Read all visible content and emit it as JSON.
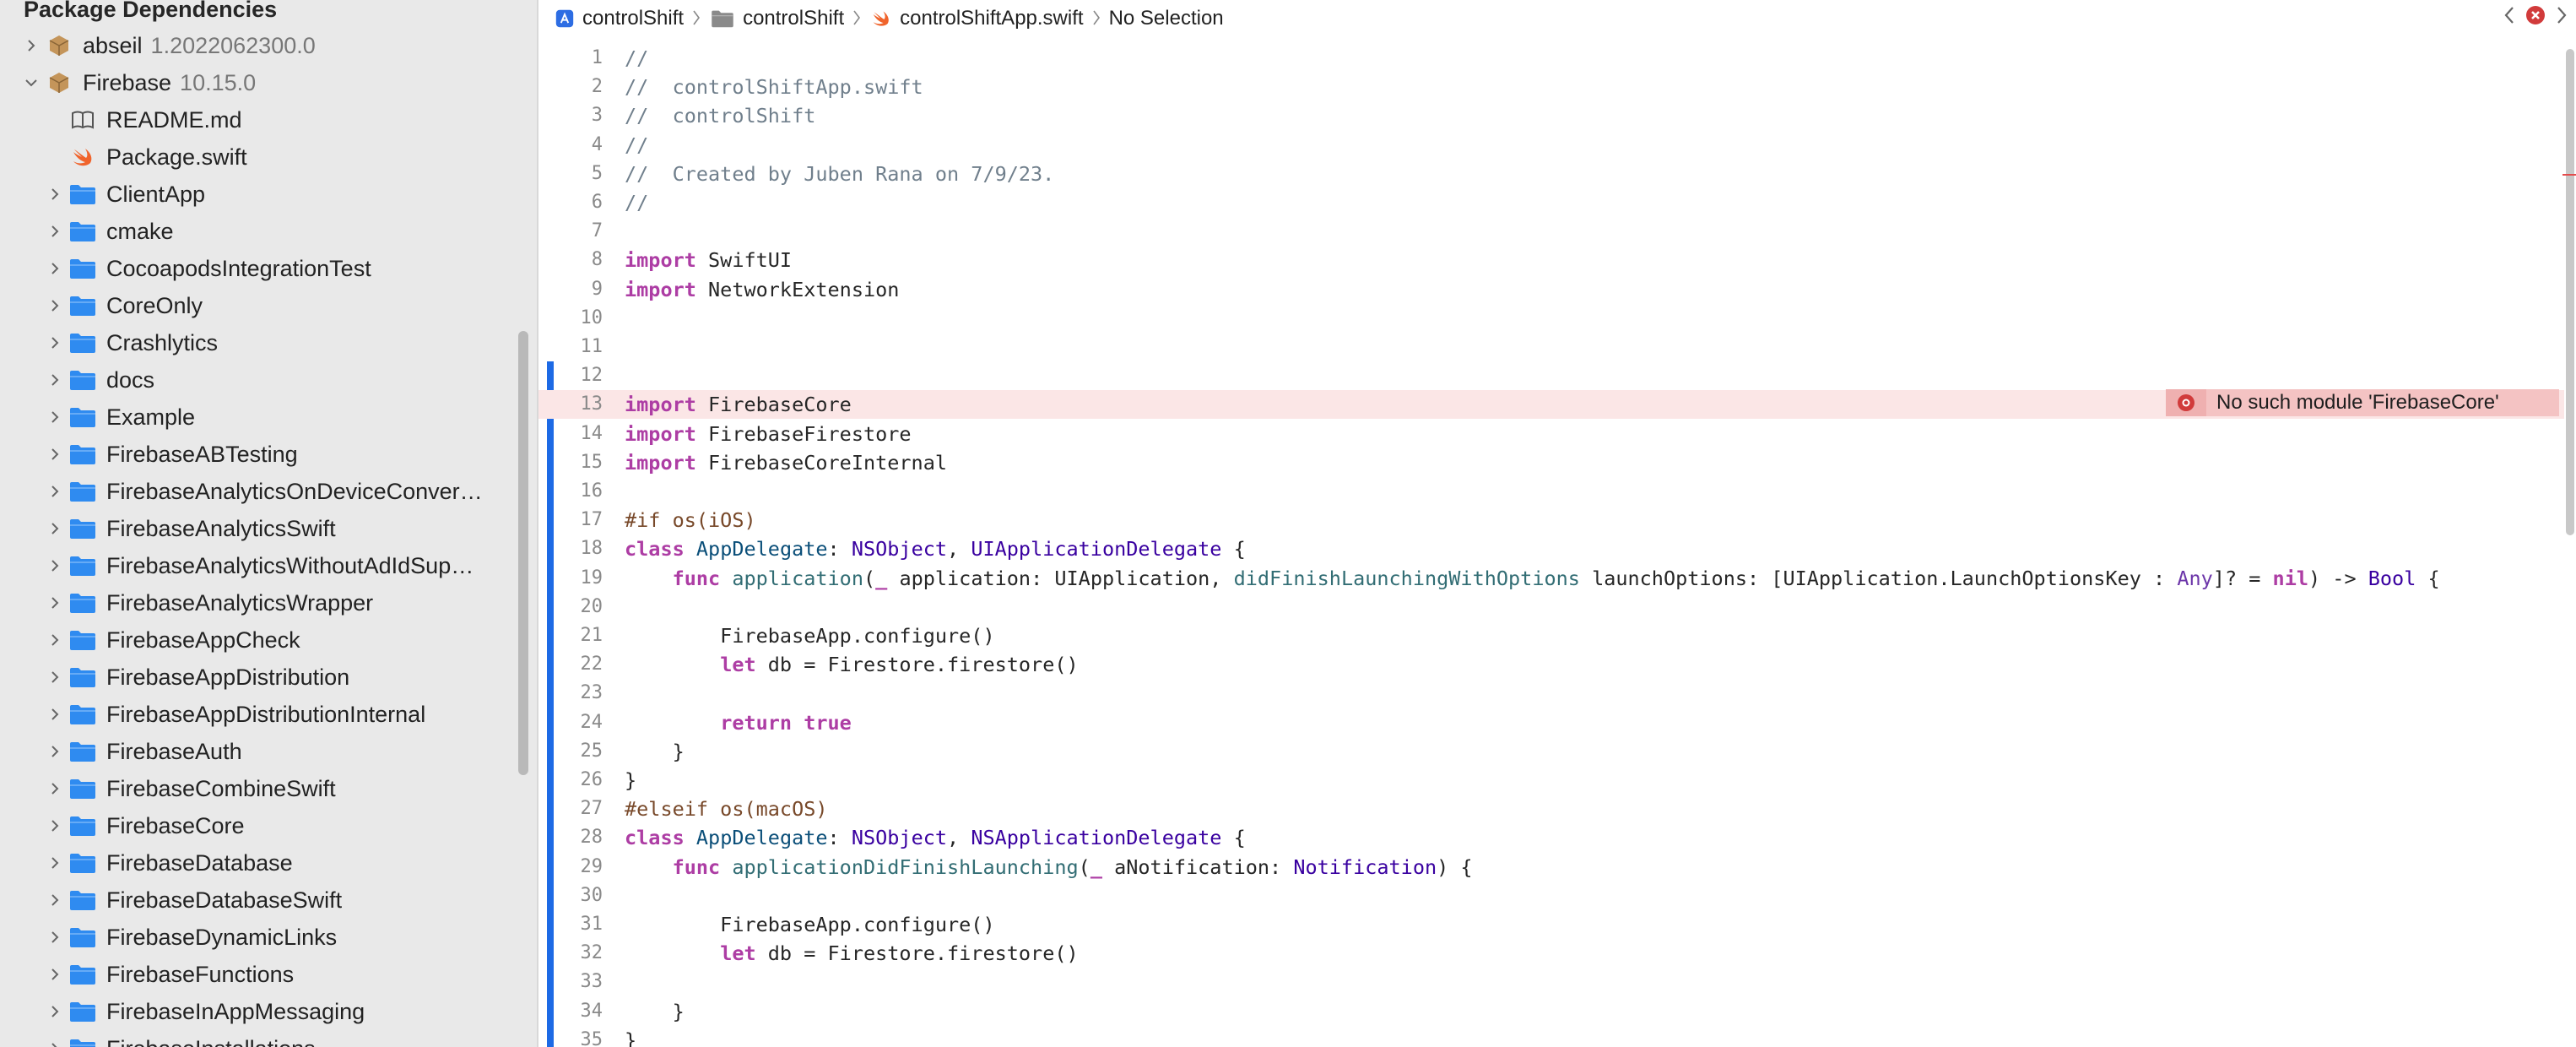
{
  "sidebar": {
    "header": "Package Dependencies",
    "rows": [
      {
        "label": "abseil",
        "version": "1.2022062300.0",
        "indent": 0,
        "icon": "package-icon",
        "expandable": true,
        "expanded": false
      },
      {
        "label": "Firebase",
        "version": "10.15.0",
        "indent": 0,
        "icon": "package-icon",
        "expandable": true,
        "expanded": true
      },
      {
        "label": "README.md",
        "version": "",
        "indent": 1,
        "icon": "book-icon",
        "expandable": false,
        "expanded": false
      },
      {
        "label": "Package.swift",
        "version": "",
        "indent": 1,
        "icon": "swift-icon",
        "expandable": false,
        "expanded": false
      },
      {
        "label": "ClientApp",
        "version": "",
        "indent": 1,
        "icon": "folder-icon",
        "expandable": true,
        "expanded": false
      },
      {
        "label": "cmake",
        "version": "",
        "indent": 1,
        "icon": "folder-icon",
        "expandable": true,
        "expanded": false
      },
      {
        "label": "CocoapodsIntegrationTest",
        "version": "",
        "indent": 1,
        "icon": "folder-icon",
        "expandable": true,
        "expanded": false
      },
      {
        "label": "CoreOnly",
        "version": "",
        "indent": 1,
        "icon": "folder-icon",
        "expandable": true,
        "expanded": false
      },
      {
        "label": "Crashlytics",
        "version": "",
        "indent": 1,
        "icon": "folder-icon",
        "expandable": true,
        "expanded": false
      },
      {
        "label": "docs",
        "version": "",
        "indent": 1,
        "icon": "folder-icon",
        "expandable": true,
        "expanded": false
      },
      {
        "label": "Example",
        "version": "",
        "indent": 1,
        "icon": "folder-icon",
        "expandable": true,
        "expanded": false
      },
      {
        "label": "FirebaseABTesting",
        "version": "",
        "indent": 1,
        "icon": "folder-icon",
        "expandable": true,
        "expanded": false
      },
      {
        "label": "FirebaseAnalyticsOnDeviceConver…",
        "version": "",
        "indent": 1,
        "icon": "folder-icon",
        "expandable": true,
        "expanded": false
      },
      {
        "label": "FirebaseAnalyticsSwift",
        "version": "",
        "indent": 1,
        "icon": "folder-icon",
        "expandable": true,
        "expanded": false
      },
      {
        "label": "FirebaseAnalyticsWithoutAdIdSup…",
        "version": "",
        "indent": 1,
        "icon": "folder-icon",
        "expandable": true,
        "expanded": false
      },
      {
        "label": "FirebaseAnalyticsWrapper",
        "version": "",
        "indent": 1,
        "icon": "folder-icon",
        "expandable": true,
        "expanded": false
      },
      {
        "label": "FirebaseAppCheck",
        "version": "",
        "indent": 1,
        "icon": "folder-icon",
        "expandable": true,
        "expanded": false
      },
      {
        "label": "FirebaseAppDistribution",
        "version": "",
        "indent": 1,
        "icon": "folder-icon",
        "expandable": true,
        "expanded": false
      },
      {
        "label": "FirebaseAppDistributionInternal",
        "version": "",
        "indent": 1,
        "icon": "folder-icon",
        "expandable": true,
        "expanded": false
      },
      {
        "label": "FirebaseAuth",
        "version": "",
        "indent": 1,
        "icon": "folder-icon",
        "expandable": true,
        "expanded": false
      },
      {
        "label": "FirebaseCombineSwift",
        "version": "",
        "indent": 1,
        "icon": "folder-icon",
        "expandable": true,
        "expanded": false
      },
      {
        "label": "FirebaseCore",
        "version": "",
        "indent": 1,
        "icon": "folder-icon",
        "expandable": true,
        "expanded": false
      },
      {
        "label": "FirebaseDatabase",
        "version": "",
        "indent": 1,
        "icon": "folder-icon",
        "expandable": true,
        "expanded": false
      },
      {
        "label": "FirebaseDatabaseSwift",
        "version": "",
        "indent": 1,
        "icon": "folder-icon",
        "expandable": true,
        "expanded": false
      },
      {
        "label": "FirebaseDynamicLinks",
        "version": "",
        "indent": 1,
        "icon": "folder-icon",
        "expandable": true,
        "expanded": false
      },
      {
        "label": "FirebaseFunctions",
        "version": "",
        "indent": 1,
        "icon": "folder-icon",
        "expandable": true,
        "expanded": false
      },
      {
        "label": "FirebaseInAppMessaging",
        "version": "",
        "indent": 1,
        "icon": "folder-icon",
        "expandable": true,
        "expanded": false
      },
      {
        "label": "FirebaseInstallations",
        "version": "",
        "indent": 1,
        "icon": "folder-icon",
        "expandable": true,
        "expanded": false
      }
    ]
  },
  "jumpbar": {
    "crumbs": [
      {
        "label": "controlShift",
        "icon": "xcode-project-icon"
      },
      {
        "label": "controlShift",
        "icon": "folder-icon"
      },
      {
        "label": "controlShiftApp.swift",
        "icon": "swift-icon"
      },
      {
        "label": "No Selection",
        "icon": ""
      }
    ]
  },
  "editor": {
    "error_line": 13,
    "error_message": "No such module 'FirebaseCore'",
    "lines": [
      {
        "n": "1",
        "tokens": [
          {
            "t": "//",
            "c": "cmt"
          }
        ]
      },
      {
        "n": "2",
        "tokens": [
          {
            "t": "//  controlShiftApp.swift",
            "c": "cmt"
          }
        ]
      },
      {
        "n": "3",
        "tokens": [
          {
            "t": "//  controlShift",
            "c": "cmt"
          }
        ]
      },
      {
        "n": "4",
        "tokens": [
          {
            "t": "//",
            "c": "cmt"
          }
        ]
      },
      {
        "n": "5",
        "tokens": [
          {
            "t": "//  Created by Juben Rana on 7/9/23.",
            "c": "cmt"
          }
        ]
      },
      {
        "n": "6",
        "tokens": [
          {
            "t": "//",
            "c": "cmt"
          }
        ]
      },
      {
        "n": "7",
        "tokens": []
      },
      {
        "n": "8",
        "tokens": [
          {
            "t": "import",
            "c": "kw"
          },
          {
            "t": " SwiftUI",
            "c": ""
          }
        ]
      },
      {
        "n": "9",
        "tokens": [
          {
            "t": "import",
            "c": "kw"
          },
          {
            "t": " NetworkExtension",
            "c": ""
          }
        ]
      },
      {
        "n": "10",
        "tokens": []
      },
      {
        "n": "11",
        "tokens": []
      },
      {
        "n": "12",
        "tokens": []
      },
      {
        "n": "13",
        "tokens": [
          {
            "t": "import",
            "c": "kw"
          },
          {
            "t": " FirebaseCore",
            "c": ""
          }
        ]
      },
      {
        "n": "14",
        "tokens": [
          {
            "t": "import",
            "c": "kw"
          },
          {
            "t": " FirebaseFirestore",
            "c": ""
          }
        ]
      },
      {
        "n": "15",
        "tokens": [
          {
            "t": "import",
            "c": "kw"
          },
          {
            "t": " FirebaseCoreInternal",
            "c": ""
          }
        ]
      },
      {
        "n": "16",
        "tokens": []
      },
      {
        "n": "17",
        "tokens": [
          {
            "t": "#if os(iOS)",
            "c": "pp"
          }
        ]
      },
      {
        "n": "18",
        "tokens": [
          {
            "t": "class",
            "c": "kw"
          },
          {
            "t": " ",
            "c": ""
          },
          {
            "t": "AppDelegate",
            "c": "tp"
          },
          {
            "t": ": ",
            "c": ""
          },
          {
            "t": "NSObject",
            "c": "type"
          },
          {
            "t": ", ",
            "c": ""
          },
          {
            "t": "UIApplicationDelegate",
            "c": "type"
          },
          {
            "t": " {",
            "c": ""
          }
        ]
      },
      {
        "n": "19",
        "tokens": [
          {
            "t": "    ",
            "c": ""
          },
          {
            "t": "func",
            "c": "kw"
          },
          {
            "t": " ",
            "c": ""
          },
          {
            "t": "application",
            "c": "fn"
          },
          {
            "t": "(",
            "c": ""
          },
          {
            "t": "_",
            "c": "kw"
          },
          {
            "t": " application: UIApplication, ",
            "c": ""
          },
          {
            "t": "didFinishLaunchingWithOptions",
            "c": "fn"
          },
          {
            "t": " launchOptions: [UIApplication.LaunchOptionsKey : ",
            "c": ""
          },
          {
            "t": "Any",
            "c": "tcol"
          },
          {
            "t": "]? = ",
            "c": ""
          },
          {
            "t": "nil",
            "c": "kw"
          },
          {
            "t": ") -> ",
            "c": ""
          },
          {
            "t": "Bool",
            "c": "type"
          },
          {
            "t": " {",
            "c": ""
          }
        ]
      },
      {
        "n": "20",
        "tokens": []
      },
      {
        "n": "21",
        "tokens": [
          {
            "t": "        FirebaseApp.configure()",
            "c": ""
          }
        ]
      },
      {
        "n": "22",
        "tokens": [
          {
            "t": "        ",
            "c": ""
          },
          {
            "t": "let",
            "c": "kw"
          },
          {
            "t": " db = Firestore.firestore()",
            "c": ""
          }
        ]
      },
      {
        "n": "23",
        "tokens": []
      },
      {
        "n": "24",
        "tokens": [
          {
            "t": "        ",
            "c": ""
          },
          {
            "t": "return",
            "c": "kw"
          },
          {
            "t": " ",
            "c": ""
          },
          {
            "t": "true",
            "c": "kw"
          }
        ]
      },
      {
        "n": "25",
        "tokens": [
          {
            "t": "    }",
            "c": ""
          }
        ]
      },
      {
        "n": "26",
        "tokens": [
          {
            "t": "}",
            "c": ""
          }
        ]
      },
      {
        "n": "27",
        "tokens": [
          {
            "t": "#elseif os(macOS)",
            "c": "pp"
          }
        ]
      },
      {
        "n": "28",
        "tokens": [
          {
            "t": "class",
            "c": "kw"
          },
          {
            "t": " ",
            "c": ""
          },
          {
            "t": "AppDelegate",
            "c": "tp"
          },
          {
            "t": ": ",
            "c": ""
          },
          {
            "t": "NSObject",
            "c": "type"
          },
          {
            "t": ", ",
            "c": ""
          },
          {
            "t": "NSApplicationDelegate",
            "c": "type"
          },
          {
            "t": " {",
            "c": ""
          }
        ]
      },
      {
        "n": "29",
        "tokens": [
          {
            "t": "    ",
            "c": ""
          },
          {
            "t": "func",
            "c": "kw"
          },
          {
            "t": " ",
            "c": ""
          },
          {
            "t": "applicationDidFinishLaunching",
            "c": "fn"
          },
          {
            "t": "(",
            "c": ""
          },
          {
            "t": "_",
            "c": "kw"
          },
          {
            "t": " aNotification: ",
            "c": ""
          },
          {
            "t": "Notification",
            "c": "type"
          },
          {
            "t": ") {",
            "c": ""
          }
        ]
      },
      {
        "n": "30",
        "tokens": []
      },
      {
        "n": "31",
        "tokens": [
          {
            "t": "        FirebaseApp.configure()",
            "c": ""
          }
        ]
      },
      {
        "n": "32",
        "tokens": [
          {
            "t": "        ",
            "c": ""
          },
          {
            "t": "let",
            "c": "kw"
          },
          {
            "t": " db = Firestore.firestore()",
            "c": ""
          }
        ]
      },
      {
        "n": "33",
        "tokens": []
      },
      {
        "n": "34",
        "tokens": [
          {
            "t": "    }",
            "c": ""
          }
        ]
      },
      {
        "n": "35",
        "tokens": [
          {
            "t": "}",
            "c": ""
          }
        ]
      }
    ]
  },
  "colors": {
    "accent": "#1d6ae5",
    "error": "#d13b3b",
    "folder": "#2f8bf0",
    "package": "#c4955a",
    "swift": "#f0642c"
  }
}
